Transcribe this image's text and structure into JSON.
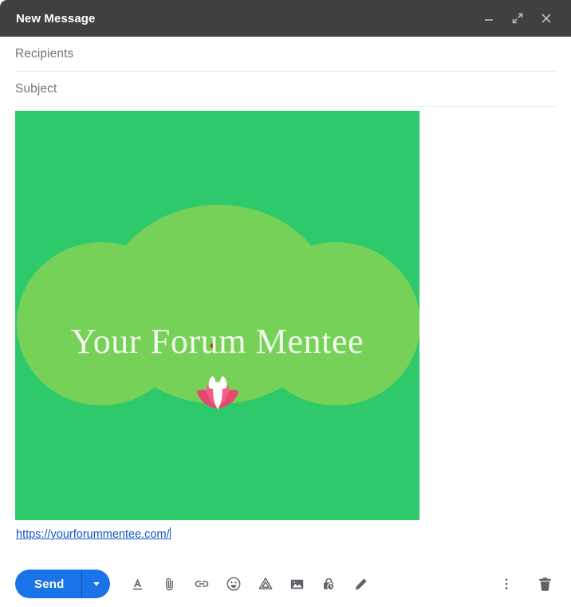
{
  "window": {
    "title": "New Message",
    "controls": [
      {
        "name": "minimize-button",
        "icon": "minimize-icon",
        "label": "Minimize"
      },
      {
        "name": "expand-button",
        "icon": "expand-icon",
        "label": "Full screen"
      },
      {
        "name": "close-button",
        "icon": "close-icon",
        "label": "Save & close"
      }
    ]
  },
  "fields": {
    "recipients": {
      "label": "Recipients",
      "value": "",
      "placeholder": "Recipients"
    },
    "subject": {
      "label": "Subject",
      "value": "",
      "placeholder": "Subject"
    }
  },
  "body": {
    "banner": {
      "title": "Your Forum Mentee",
      "background_color": "#2dc96b",
      "cloud_color": "#76d158",
      "title_color": "#f3f9ec",
      "dot_color": "#dd1111",
      "flower_colors": {
        "petal": "#e8456f",
        "petal_light": "#f386a6",
        "center": "#ffffff"
      }
    },
    "link": {
      "text": "https://yourforummentee.com/",
      "color": "#1155cc"
    }
  },
  "toolbar": {
    "send_label": "Send",
    "send_color": "#1a73e8",
    "send_options_icon": "chevron-down-icon",
    "tools": [
      {
        "name": "formatting-options-button",
        "icon": "format-text-icon",
        "label": "Formatting options"
      },
      {
        "name": "attach-files-button",
        "icon": "paperclip-icon",
        "label": "Attach files"
      },
      {
        "name": "insert-link-button",
        "icon": "link-icon",
        "label": "Insert link"
      },
      {
        "name": "insert-emoji-button",
        "icon": "emoji-icon",
        "label": "Insert emoji"
      },
      {
        "name": "insert-drive-file-button",
        "icon": "drive-icon",
        "label": "Insert files using Drive"
      },
      {
        "name": "insert-photo-button",
        "icon": "image-icon",
        "label": "Insert photo"
      },
      {
        "name": "confidential-mode-button",
        "icon": "lock-clock-icon",
        "label": "Toggle confidential mode"
      },
      {
        "name": "insert-signature-button",
        "icon": "pen-icon",
        "label": "Insert signature"
      }
    ],
    "right_tools": [
      {
        "name": "more-options-button",
        "icon": "more-vertical-icon",
        "label": "More options"
      },
      {
        "name": "discard-draft-button",
        "icon": "trash-icon",
        "label": "Discard draft"
      }
    ]
  }
}
